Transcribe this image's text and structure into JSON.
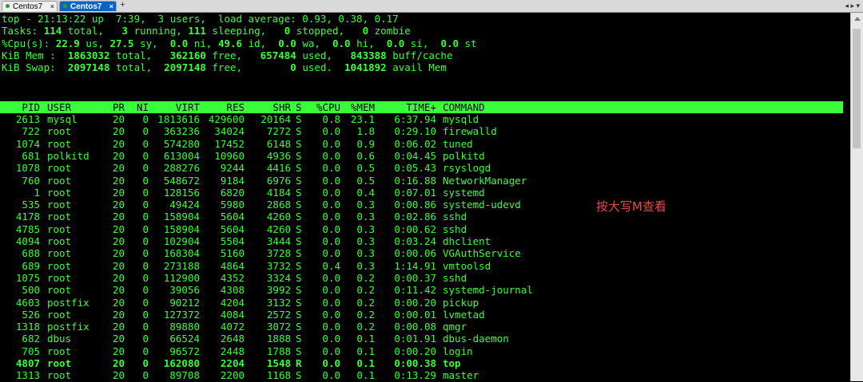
{
  "tabs": [
    {
      "label": "Centos7",
      "active": false
    },
    {
      "label": "Centos7",
      "active": true
    }
  ],
  "terminal": {
    "summary": {
      "line1": "top - 21:13:22 up  7:39,  3 users,  load average: 0.93, 0.38, 0.17",
      "tasks": {
        "prefix": "Tasks: ",
        "total": "114",
        "running": "3",
        "sleeping": "111",
        "stopped": "0",
        "zombie": "0"
      },
      "cpu": {
        "prefix": "%Cpu(s): ",
        "us": "22.9",
        "sy": "27.5",
        "ni": "0.0",
        "id": "49.6",
        "wa": "0.0",
        "hi": "0.0",
        "si": "0.0",
        "st": "0.0"
      },
      "mem": {
        "prefix": "KiB Mem :  ",
        "total": "1863032",
        "free": "362160",
        "used": "657484",
        "buff_cache": "843388"
      },
      "swap": {
        "prefix": "KiB Swap:  ",
        "total": "2097148",
        "free": "2097148",
        "used": "0",
        "avail": "1041892"
      }
    },
    "columns": [
      "PID",
      "USER",
      "PR",
      "NI",
      "VIRT",
      "RES",
      "SHR",
      "S",
      "%CPU",
      "%MEM",
      "TIME+",
      "COMMAND"
    ],
    "processes": [
      [
        "2613",
        "mysql",
        "20",
        "0",
        "1813616",
        "429600",
        "20164",
        "S",
        "0.8",
        "23.1",
        "6:37.94",
        "mysqld"
      ],
      [
        "722",
        "root",
        "20",
        "0",
        "363236",
        "34024",
        "7272",
        "S",
        "0.0",
        "1.8",
        "0:29.10",
        "firewalld"
      ],
      [
        "1074",
        "root",
        "20",
        "0",
        "574280",
        "17452",
        "6148",
        "S",
        "0.0",
        "0.9",
        "0:06.02",
        "tuned"
      ],
      [
        "681",
        "polkitd",
        "20",
        "0",
        "613004",
        "10960",
        "4936",
        "S",
        "0.0",
        "0.6",
        "0:04.45",
        "polkitd"
      ],
      [
        "1078",
        "root",
        "20",
        "0",
        "288276",
        "9244",
        "4416",
        "S",
        "0.0",
        "0.5",
        "0:05.43",
        "rsyslogd"
      ],
      [
        "760",
        "root",
        "20",
        "0",
        "548672",
        "9184",
        "6976",
        "S",
        "0.0",
        "0.5",
        "0:16.88",
        "NetworkManager"
      ],
      [
        "1",
        "root",
        "20",
        "0",
        "128156",
        "6820",
        "4184",
        "S",
        "0.0",
        "0.4",
        "0:07.01",
        "systemd"
      ],
      [
        "535",
        "root",
        "20",
        "0",
        "49424",
        "5980",
        "2868",
        "S",
        "0.0",
        "0.3",
        "0:00.86",
        "systemd-udevd"
      ],
      [
        "4178",
        "root",
        "20",
        "0",
        "158904",
        "5604",
        "4260",
        "S",
        "0.0",
        "0.3",
        "0:02.86",
        "sshd"
      ],
      [
        "4785",
        "root",
        "20",
        "0",
        "158904",
        "5604",
        "4260",
        "S",
        "0.0",
        "0.3",
        "0:00.62",
        "sshd"
      ],
      [
        "4094",
        "root",
        "20",
        "0",
        "102904",
        "5504",
        "3444",
        "S",
        "0.0",
        "0.3",
        "0:03.24",
        "dhclient"
      ],
      [
        "688",
        "root",
        "20",
        "0",
        "168304",
        "5160",
        "3728",
        "S",
        "0.0",
        "0.3",
        "0:00.06",
        "VGAuthService"
      ],
      [
        "689",
        "root",
        "20",
        "0",
        "273188",
        "4864",
        "3732",
        "S",
        "0.4",
        "0.3",
        "1:14.91",
        "vmtoolsd"
      ],
      [
        "1075",
        "root",
        "20",
        "0",
        "112900",
        "4352",
        "3324",
        "S",
        "0.0",
        "0.2",
        "0:00.37",
        "sshd"
      ],
      [
        "500",
        "root",
        "20",
        "0",
        "39056",
        "4308",
        "3992",
        "S",
        "0.0",
        "0.2",
        "0:11.42",
        "systemd-journal"
      ],
      [
        "4603",
        "postfix",
        "20",
        "0",
        "90212",
        "4204",
        "3132",
        "S",
        "0.0",
        "0.2",
        "0:00.20",
        "pickup"
      ],
      [
        "526",
        "root",
        "20",
        "0",
        "127372",
        "4084",
        "2572",
        "S",
        "0.0",
        "0.2",
        "0:00.01",
        "lvmetad"
      ],
      [
        "1318",
        "postfix",
        "20",
        "0",
        "89880",
        "4072",
        "3072",
        "S",
        "0.0",
        "0.2",
        "0:00.08",
        "qmgr"
      ],
      [
        "682",
        "dbus",
        "20",
        "0",
        "66524",
        "2648",
        "1888",
        "S",
        "0.0",
        "0.1",
        "0:01.91",
        "dbus-daemon"
      ],
      [
        "705",
        "root",
        "20",
        "0",
        "96572",
        "2448",
        "1788",
        "S",
        "0.0",
        "0.1",
        "0:00.20",
        "login"
      ],
      [
        "4807",
        "root",
        "20",
        "0",
        "162080",
        "2204",
        "1548",
        "R",
        "0.0",
        "0.1",
        "0:00.38",
        "top"
      ],
      [
        "1313",
        "root",
        "20",
        "0",
        "89708",
        "2200",
        "1168",
        "S",
        "0.0",
        "0.1",
        "0:13.29",
        "master"
      ]
    ],
    "bold_row_index": 20
  },
  "annotation": "按大写M查看",
  "colors": {
    "terminal_text": "#39ff39",
    "annotation": "#e84a4a",
    "active_tab": "#0a64c8"
  }
}
